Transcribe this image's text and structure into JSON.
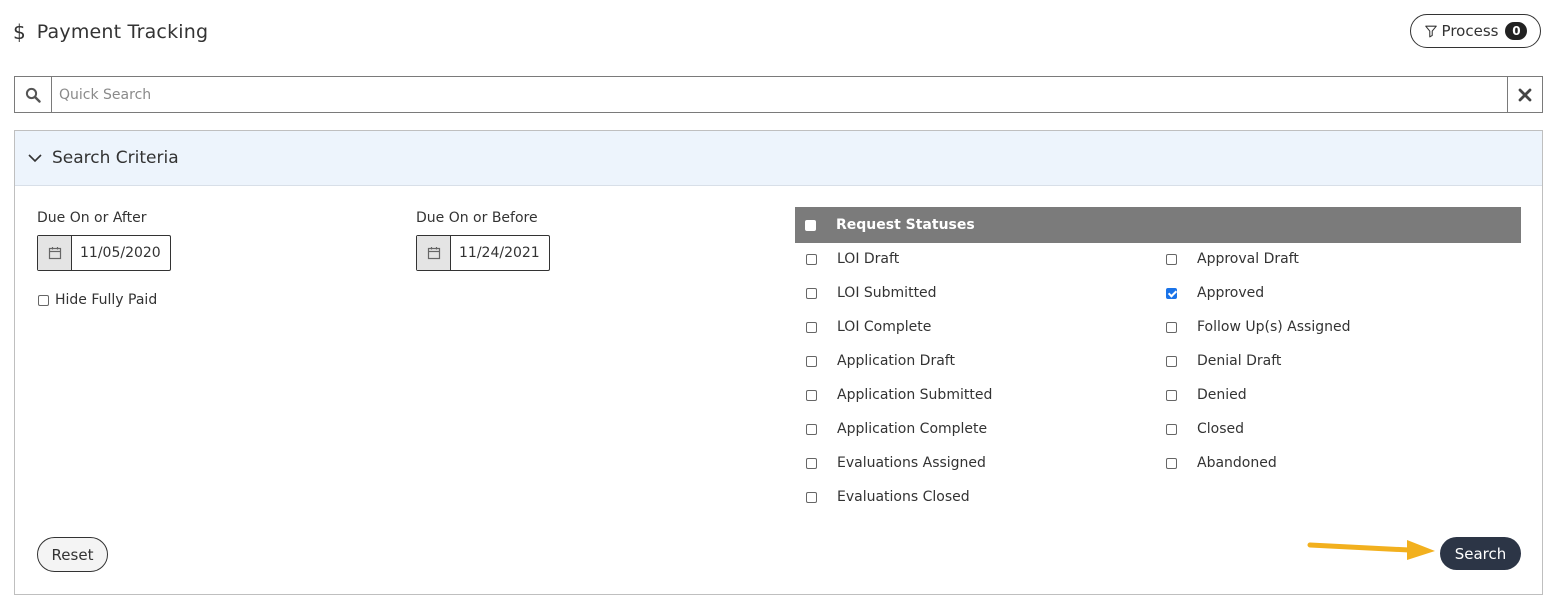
{
  "header": {
    "title": "Payment Tracking",
    "process_label": "Process",
    "process_count": "0"
  },
  "quick_search": {
    "placeholder": "Quick Search",
    "value": ""
  },
  "criteria": {
    "title": "Search Criteria",
    "due_after": {
      "label": "Due On or After",
      "value": "11/05/2020"
    },
    "due_before": {
      "label": "Due On or Before",
      "value": "11/24/2021"
    },
    "hide_paid": {
      "label": "Hide Fully Paid",
      "checked": false
    },
    "statuses_title": "Request Statuses",
    "statuses_col1": [
      {
        "label": "LOI Draft",
        "checked": false
      },
      {
        "label": "LOI Submitted",
        "checked": false
      },
      {
        "label": "LOI Complete",
        "checked": false
      },
      {
        "label": "Application Draft",
        "checked": false
      },
      {
        "label": "Application Submitted",
        "checked": false
      },
      {
        "label": "Application Complete",
        "checked": false
      },
      {
        "label": "Evaluations Assigned",
        "checked": false
      },
      {
        "label": "Evaluations Closed",
        "checked": false
      }
    ],
    "statuses_col2": [
      {
        "label": "Approval Draft",
        "checked": false
      },
      {
        "label": "Approved",
        "checked": true
      },
      {
        "label": "Follow Up(s) Assigned",
        "checked": false
      },
      {
        "label": "Denial Draft",
        "checked": false
      },
      {
        "label": "Denied",
        "checked": false
      },
      {
        "label": "Closed",
        "checked": false
      },
      {
        "label": "Abandoned",
        "checked": false
      }
    ],
    "reset_label": "Reset",
    "search_label": "Search"
  },
  "colors": {
    "accent_checkbox": "#1a73e8",
    "header_bg": "#edf4fc",
    "status_header_bg": "#7b7b7b",
    "search_button_bg": "#2c3546",
    "arrow": "#f2b01e"
  }
}
